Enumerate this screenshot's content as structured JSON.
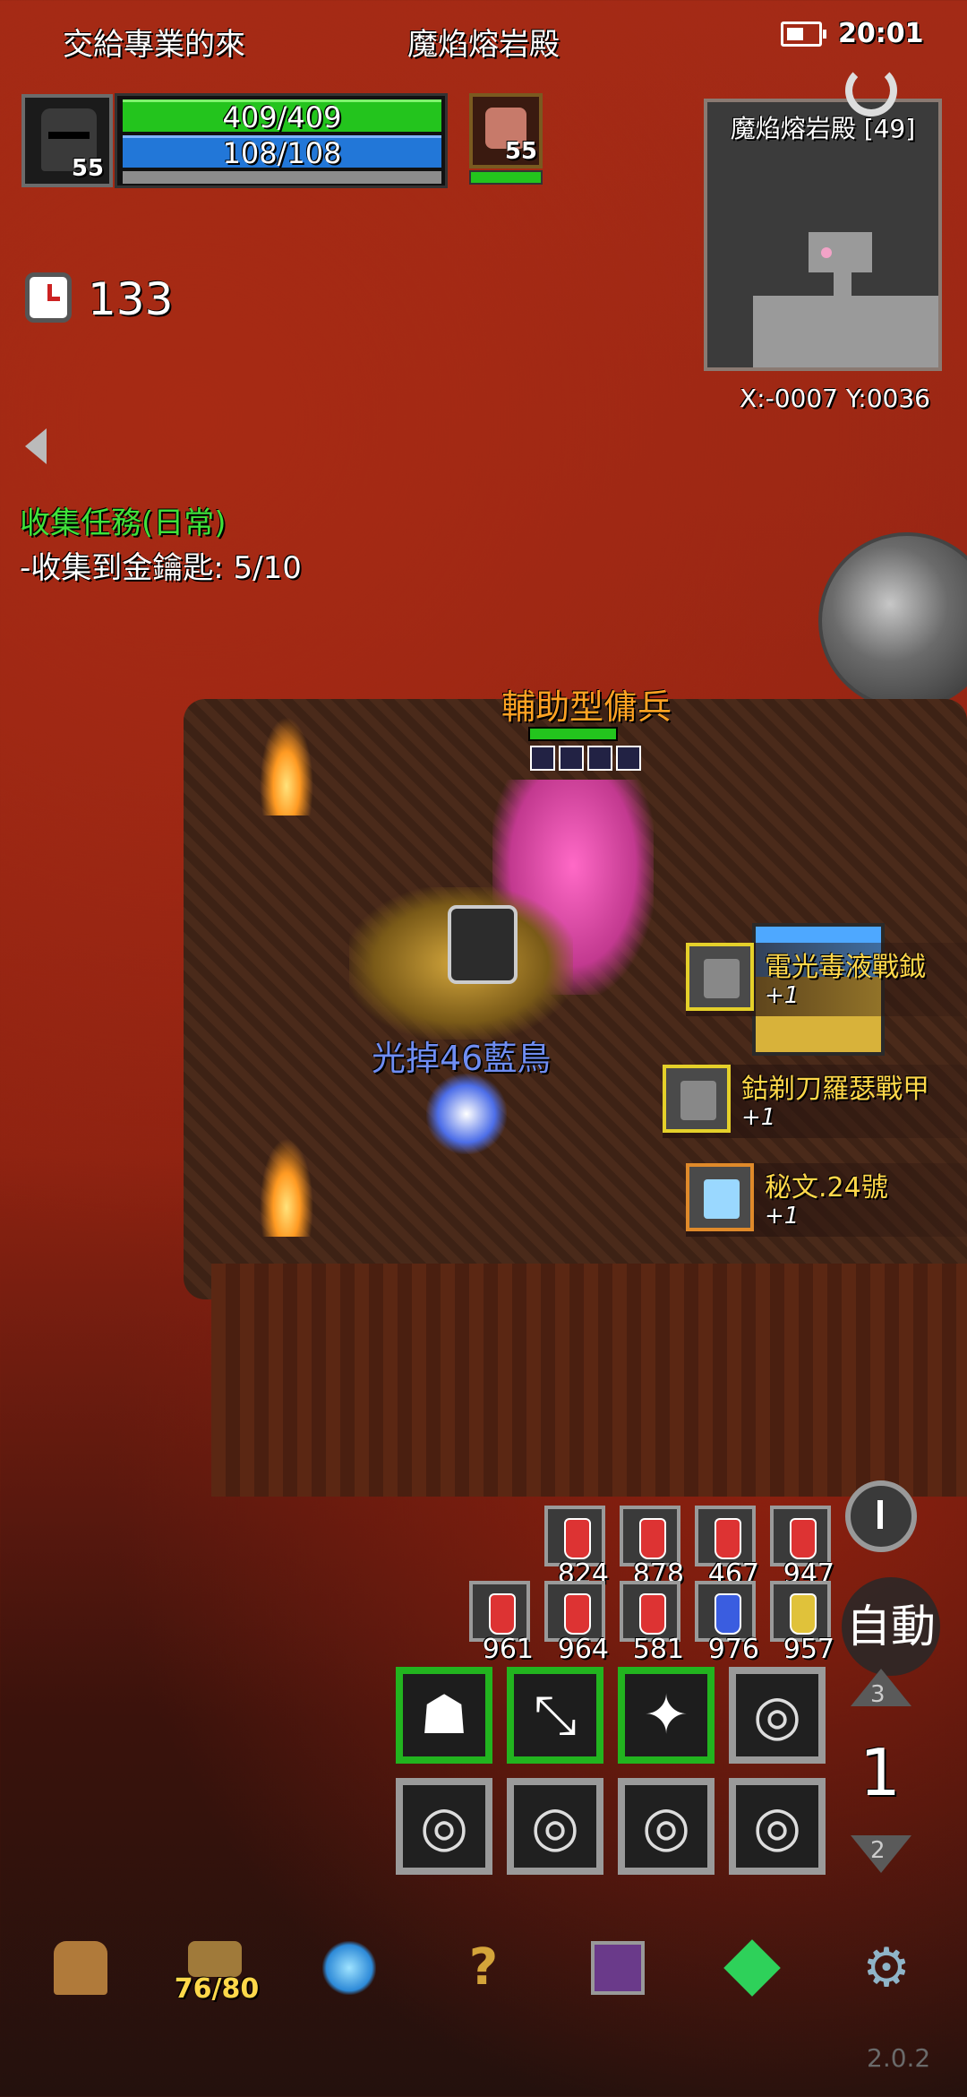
{
  "status_bar": {
    "notification_text": "交給專業的來",
    "map_name": "魔焰熔岩殿",
    "time": "20:01"
  },
  "player": {
    "level": "55",
    "hp_text": "409/409",
    "mp_text": "108/108",
    "hp_fraction": 1.0,
    "mp_fraction": 1.0
  },
  "pet": {
    "level": "55",
    "hp_fraction": 1.0
  },
  "minimap": {
    "title": "魔焰熔岩殿 [49]",
    "coords": "X:-0007  Y:0036"
  },
  "timer": {
    "value": "133"
  },
  "quest": {
    "title": "收集任務(日常)",
    "item": "-收集到金鑰匙: 5/10"
  },
  "world": {
    "npc_name": "輔助型傭兵",
    "pickup_text": "光掉46藍鳥"
  },
  "loot": [
    {
      "name": "電光毒液戰鉞",
      "plus": "+1",
      "icon": "axe-icon"
    },
    {
      "name": "鈷剃刀羅瑟戰甲",
      "plus": "+1",
      "icon": "armor-icon"
    },
    {
      "name": "秘文.24號",
      "plus": "+1",
      "icon": "scroll-icon"
    }
  ],
  "potions": {
    "row1": [
      "824",
      "878",
      "467",
      "947"
    ],
    "row2": [
      "961",
      "964",
      "581",
      "976",
      "957"
    ]
  },
  "controls": {
    "auto_label": "自動",
    "page_up": "3",
    "page_current": "1",
    "page_down": "2"
  },
  "skills": {
    "row1": [
      "ghost-icon",
      "arrows-icon",
      "bird-icon",
      "empty-slot-icon"
    ],
    "row2": [
      "empty-slot-icon",
      "empty-slot-icon",
      "empty-slot-icon",
      "empty-slot-icon"
    ]
  },
  "bottom_menu": {
    "inventory_count": "76/80"
  },
  "version": "2.0.2"
}
